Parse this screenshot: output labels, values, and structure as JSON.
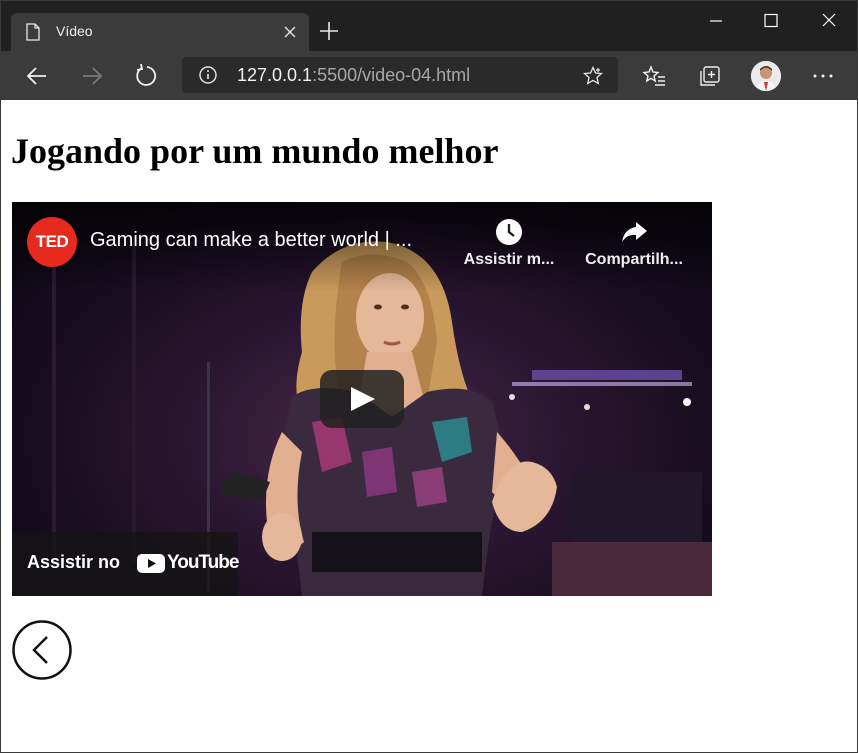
{
  "browser": {
    "tab_title": "Vídeo",
    "url_host": "127.0.0.1",
    "url_rest": ":5500/video-04.html"
  },
  "page": {
    "heading": "Jogando por um mundo melhor"
  },
  "video": {
    "channel_logo": "TED",
    "title": "Gaming can make a better world | ...",
    "watch_later_label": "Assistir m...",
    "share_label": "Compartilh...",
    "watch_on_label": "Assistir no",
    "youtube_label": "YouTube"
  },
  "icons": {
    "page": "page-icon",
    "close": "close-icon",
    "new_tab": "plus-icon",
    "back": "arrow-left-icon",
    "forward": "arrow-right-icon",
    "refresh": "refresh-icon",
    "info": "info-icon",
    "favorite": "star-icon",
    "favorites": "favorites-icon",
    "collections": "collections-icon",
    "more": "more-icon",
    "play": "play-icon",
    "clock": "clock-icon",
    "share": "share-icon",
    "chevron_back": "chevron-left-circle-icon"
  },
  "colors": {
    "ted_red": "#e62b1e",
    "chrome_dark": "#202020",
    "toolbar": "#3b3b3b"
  }
}
